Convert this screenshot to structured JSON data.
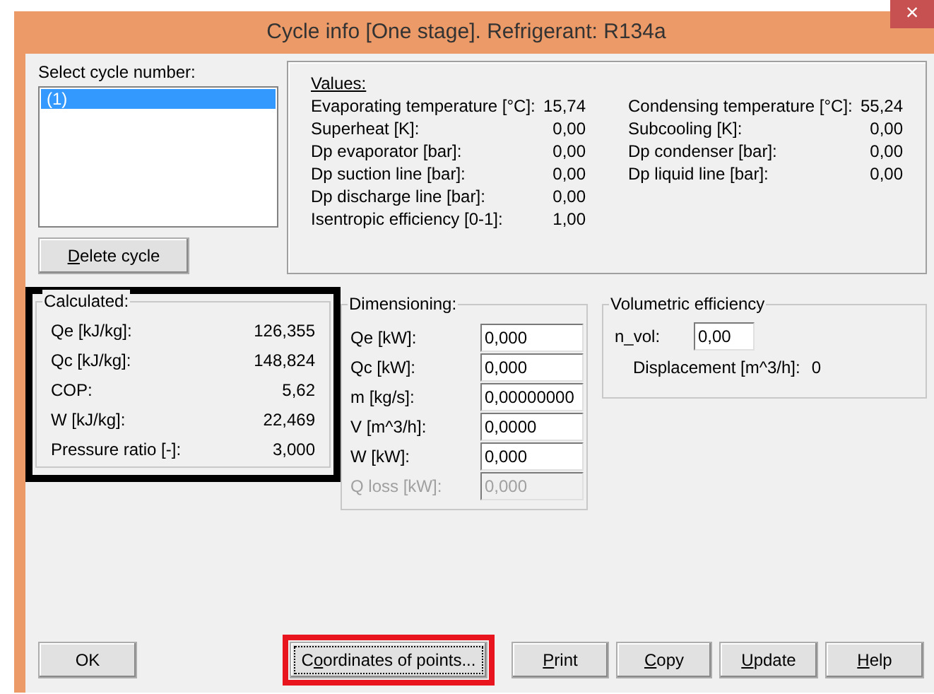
{
  "window": {
    "title": "Cycle info [One stage]. Refrigerant: R134a",
    "close": "×"
  },
  "cycle_list": {
    "label": "Select cycle number:",
    "items": [
      {
        "label": "(1)",
        "selected": true
      }
    ]
  },
  "delete_button": {
    "hotkey": "D",
    "after": "elete cycle"
  },
  "values": {
    "title": "Values:",
    "columns": [
      [
        {
          "label": "Evaporating temperature [°C]:",
          "value": "15,74"
        },
        {
          "label": "Superheat [K]:",
          "value": "0,00"
        },
        {
          "label": "Dp evaporator [bar]:",
          "value": "0,00"
        },
        {
          "label": "Dp suction line [bar]:",
          "value": "0,00"
        },
        {
          "label": "Dp discharge line [bar]:",
          "value": "0,00"
        },
        {
          "label": "Isentropic efficiency [0-1]:",
          "value": "1,00"
        }
      ],
      [
        {
          "label": "Condensing temperature [°C]:",
          "value": "55,24"
        },
        {
          "label": "Subcooling [K]:",
          "value": "0,00"
        },
        {
          "label": "Dp condenser [bar]:",
          "value": "0,00"
        },
        {
          "label": "Dp liquid line [bar]:",
          "value": "0,00"
        }
      ]
    ]
  },
  "calculated": {
    "title": "Calculated:",
    "rows": [
      {
        "label": "Qe [kJ/kg]:",
        "value": "126,355"
      },
      {
        "label": "Qc [kJ/kg]:",
        "value": "148,824"
      },
      {
        "label": "COP:",
        "value": "5,62"
      },
      {
        "label": "W [kJ/kg]:",
        "value": "22,469"
      },
      {
        "label": "Pressure ratio [-]:",
        "value": "3,000"
      }
    ]
  },
  "dimensioning": {
    "title": "Dimensioning:",
    "rows": [
      {
        "label": "Qe [kW]:",
        "value": "0,000",
        "disabled": false
      },
      {
        "label": "Qc [kW]:",
        "value": "0,000",
        "disabled": false
      },
      {
        "label": "m [kg/s]:",
        "value": "0,00000000",
        "disabled": false
      },
      {
        "label": "V [m^3/h]:",
        "value": "0,0000",
        "disabled": false
      },
      {
        "label": "W [kW]:",
        "value": "0,000",
        "disabled": false
      },
      {
        "label": "Q loss [kW]:",
        "value": "0,000",
        "disabled": true
      }
    ]
  },
  "volumetric": {
    "title": "Volumetric efficiency",
    "n_vol_label": "n_vol:",
    "n_vol": "0,00",
    "displacement_label": "Displacement [m^3/h]:",
    "displacement": "0"
  },
  "buttons": [
    {
      "after": "OK",
      "highlighted": false
    },
    {
      "before": "C",
      "hotkey": "o",
      "after": "ordinates of points...",
      "highlighted": true
    },
    {
      "hotkey": "P",
      "after": "rint",
      "highlighted": false
    },
    {
      "hotkey": "C",
      "after": "opy",
      "highlighted": false
    },
    {
      "hotkey": "U",
      "after": "pdate",
      "highlighted": false
    },
    {
      "hotkey": "H",
      "after": "elp",
      "highlighted": false
    }
  ]
}
